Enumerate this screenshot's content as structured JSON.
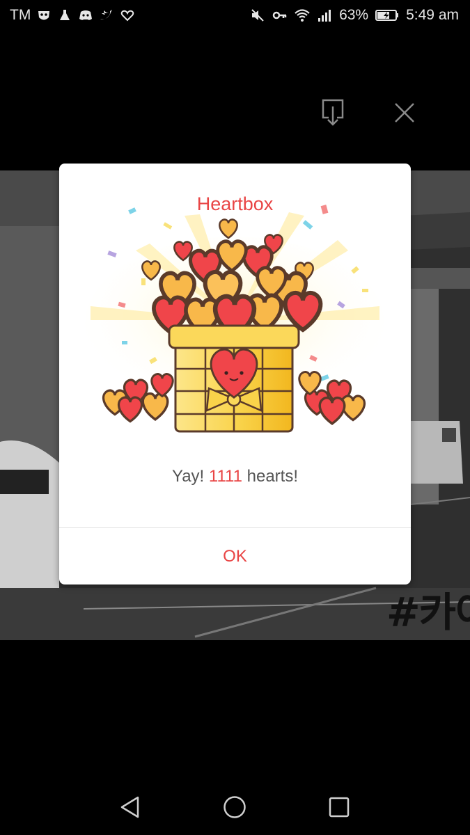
{
  "status_bar": {
    "carrier": "TM",
    "battery": "63%",
    "time": "5:49 am",
    "left_icons": [
      "mask-icon",
      "flask-icon",
      "discord-icon",
      "twitter-icon",
      "heart-outline-icon"
    ],
    "right_icons": [
      "mute-icon",
      "key-icon",
      "wifi-icon",
      "signal-icon",
      "battery-charging-icon"
    ]
  },
  "top_actions": {
    "download_icon": "download-icon",
    "close_icon": "close-icon"
  },
  "background": {
    "hashtag_text": "#카이"
  },
  "dialog": {
    "title": "Heartbox",
    "message_prefix": "Yay! ",
    "heart_count": "1111",
    "message_suffix": " hearts!",
    "ok_label": "OK",
    "illustration": "heartbox-gift-illustration"
  },
  "nav_bar": {
    "back_icon": "back-triangle-icon",
    "home_icon": "home-circle-icon",
    "recents_icon": "recents-square-icon"
  },
  "colors": {
    "accent": "#e94545",
    "message_text": "#555555",
    "overlay": "#000000"
  }
}
